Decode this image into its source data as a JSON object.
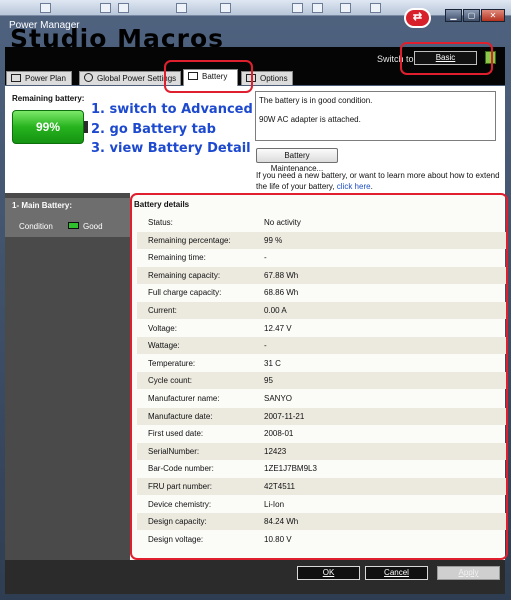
{
  "window": {
    "title": "Power Manager",
    "overlay_title": "Studio Macros",
    "minimize": "▁",
    "maximize": "▢",
    "close": "✕"
  },
  "header": {
    "switch_label": "Switch to:",
    "mode_button": "Basic"
  },
  "tabs": [
    {
      "label": "Power Plan",
      "icon": "power-plan-icon"
    },
    {
      "label": "Global Power Settings",
      "icon": "gear-icon"
    },
    {
      "label": "Battery",
      "icon": "battery-icon"
    },
    {
      "label": "Options",
      "icon": "checkbox-icon"
    }
  ],
  "battery": {
    "remaining_label": "Remaining battery:",
    "percent": "99%",
    "level": 0.99
  },
  "annotations": [
    "1. switch to Advanced",
    "2. go Battery tab",
    "3. view Battery Detail"
  ],
  "status": {
    "line1": "The battery is in good condition.",
    "line2": "90W AC adapter is attached."
  },
  "maintenance_button": "Battery Maintenance...",
  "help": {
    "text": "If you need a new battery, or want to learn more about how to extend the life of your battery, ",
    "link": "click here",
    "end": "."
  },
  "sidebar": {
    "title": "1- Main Battery:",
    "condition_label": "Condition",
    "condition_value": "Good"
  },
  "details": {
    "title": "Battery details",
    "rows": [
      {
        "label": "Status:",
        "value": "No activity"
      },
      {
        "label": "Remaining percentage:",
        "value": "99 %"
      },
      {
        "label": "Remaining time:",
        "value": "-"
      },
      {
        "label": "Remaining capacity:",
        "value": "67.88 Wh"
      },
      {
        "label": "Full charge capacity:",
        "value": "68.86 Wh"
      },
      {
        "label": "Current:",
        "value": "0.00 A"
      },
      {
        "label": "Voltage:",
        "value": "12.47 V"
      },
      {
        "label": "Wattage:",
        "value": "-"
      },
      {
        "label": "Temperature:",
        "value": "31 C"
      },
      {
        "label": "Cycle count:",
        "value": "95"
      },
      {
        "label": "Manufacturer name:",
        "value": "SANYO"
      },
      {
        "label": "Manufacture date:",
        "value": "2007-11-21"
      },
      {
        "label": "First used date:",
        "value": "2008-01"
      },
      {
        "label": "SerialNumber:",
        "value": "12423"
      },
      {
        "label": "Bar-Code number:",
        "value": "1ZE1J7BM9L3"
      },
      {
        "label": "FRU part number:",
        "value": "42T4511"
      },
      {
        "label": "Device chemistry:",
        "value": "Li-Ion"
      },
      {
        "label": "Design capacity:",
        "value": "84.24 Wh"
      },
      {
        "label": "Design voltage:",
        "value": "10.80 V"
      }
    ]
  },
  "footer": {
    "ok": "OK",
    "cancel": "Cancel",
    "apply": "Apply"
  },
  "colors": {
    "annotation_blue": "#1d49cf",
    "highlight_red": "#e01f2e",
    "battery_green": "#27b31e"
  }
}
